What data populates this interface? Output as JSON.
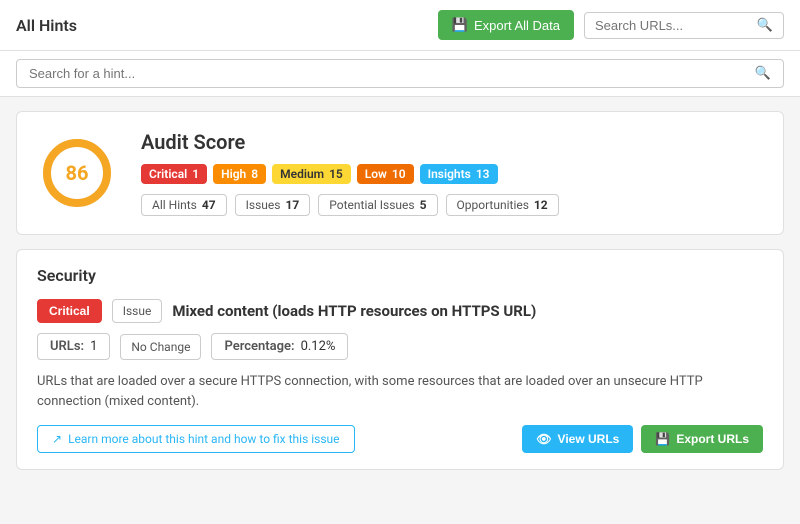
{
  "header": {
    "title": "All Hints",
    "export_all_label": "Export All Data",
    "search_placeholder": "Search URLs..."
  },
  "hint_search": {
    "placeholder": "Search for a hint..."
  },
  "audit": {
    "title": "Audit Score",
    "score": "86",
    "donut_pct": 86,
    "badges": [
      {
        "label": "Critical",
        "count": "1",
        "type": "critical"
      },
      {
        "label": "High",
        "count": "8",
        "type": "high"
      },
      {
        "label": "Medium",
        "count": "15",
        "type": "medium"
      },
      {
        "label": "Low",
        "count": "10",
        "type": "low"
      },
      {
        "label": "Insights",
        "count": "13",
        "type": "insights"
      }
    ],
    "filters": [
      {
        "label": "All Hints",
        "count": "47"
      },
      {
        "label": "Issues",
        "count": "17"
      },
      {
        "label": "Potential Issues",
        "count": "5"
      },
      {
        "label": "Opportunities",
        "count": "12"
      }
    ]
  },
  "security": {
    "section_title": "Security",
    "severity_label": "Critical",
    "issue_type": "Issue",
    "issue_title": "Mixed content (loads HTTP resources on HTTPS URL)",
    "urls_label": "URLs:",
    "urls_count": "1",
    "no_change": "No Change",
    "percentage_label": "Percentage:",
    "percentage_value": "0.12%",
    "description": "URLs that are loaded over a secure HTTPS connection, with some resources that are loaded over an unsecure HTTP connection (mixed content).",
    "learn_more": "Learn more about this hint and how to fix this issue",
    "view_urls_label": "View URLs",
    "export_urls_label": "Export URLs"
  }
}
